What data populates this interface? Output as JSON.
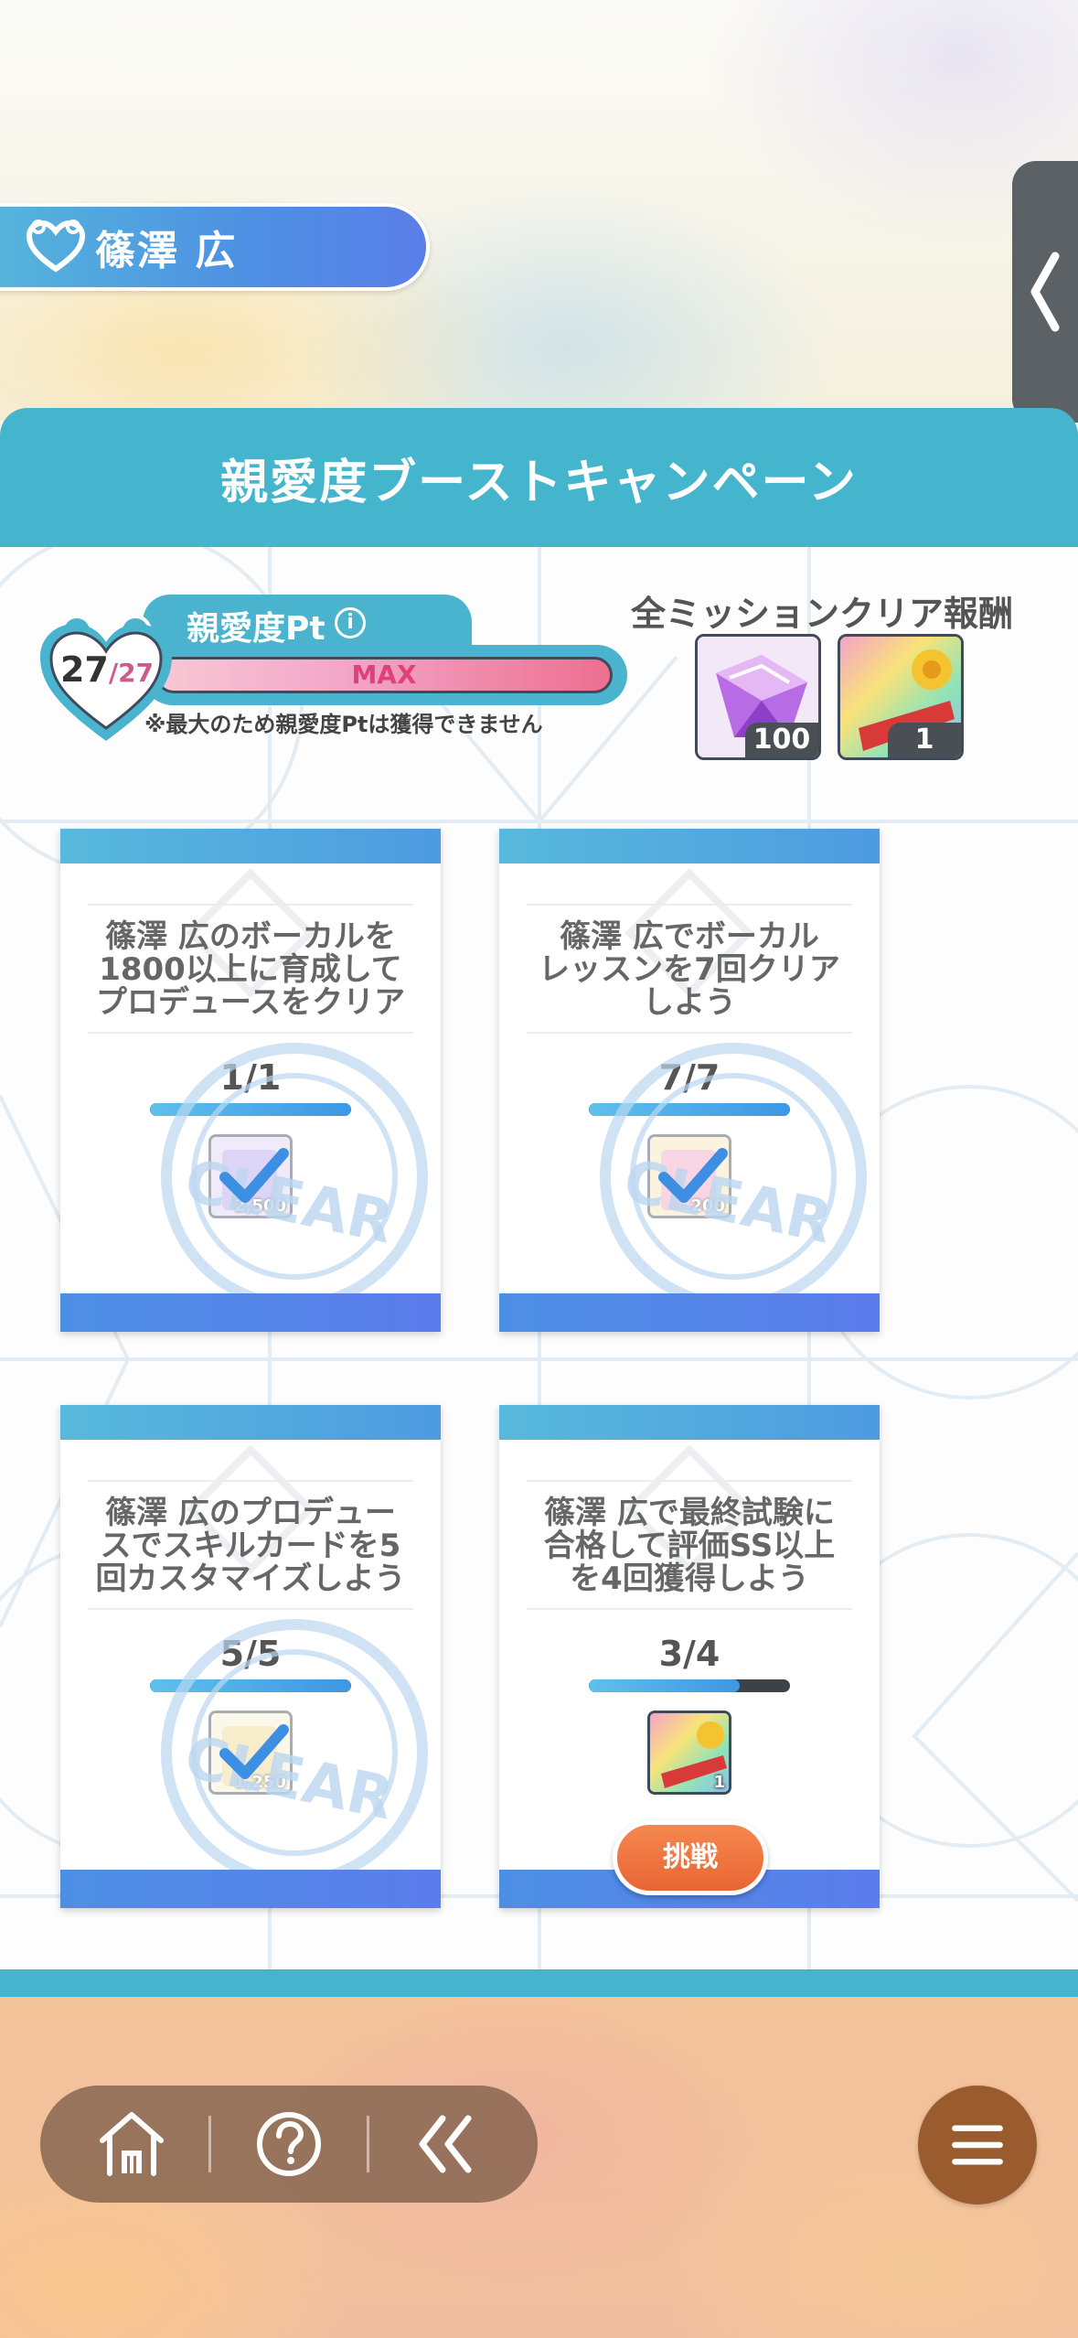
{
  "character": {
    "name": "篠澤 広"
  },
  "campaign": {
    "title": "親愛度ブーストキャンペーン"
  },
  "affection": {
    "label": "親愛度Pt",
    "info_symbol": "i",
    "current": "27",
    "max": "/27",
    "bar_label": "MAX",
    "fill_fraction": 1.0,
    "note": "※最大のため親愛度Ptは獲得できません"
  },
  "all_mission_reward": {
    "title": "全ミッションクリア報酬",
    "items": [
      {
        "icon": "jewel-icon",
        "count": "100"
      },
      {
        "icon": "support-card-book-icon",
        "count": "1"
      }
    ]
  },
  "missions": [
    {
      "text": "篠澤 広のボーカルを\n1800以上に育成して\nプロデュースをクリア",
      "progress": "1/1",
      "fraction": 1.0,
      "reward_count": "2,500",
      "cleared": true,
      "clear_text": "CLEAR"
    },
    {
      "text": "篠澤 広でボーカル\nレッスンを7回クリア\nしよう",
      "progress": "7/7",
      "fraction": 1.0,
      "reward_count": "200",
      "cleared": true,
      "clear_text": "CLEAR"
    },
    {
      "text": "篠澤 広のプロデュー\nスでスキルカードを5\n回カスタマイズしよう",
      "progress": "5/5",
      "fraction": 1.0,
      "reward_count": "1,250",
      "cleared": true,
      "clear_text": "CLEAR"
    },
    {
      "text": "篠澤 広で最終試験に\n合格して評価SS以上\nを4回獲得しよう",
      "progress": "3/4",
      "fraction": 0.75,
      "reward_count": "1",
      "cleared": false
    }
  ],
  "challenge_button": {
    "label": "挑戦"
  },
  "nav": {
    "home_icon": "home-icon",
    "help_icon": "help-icon",
    "back_icon": "back-icon",
    "menu_icon": "menu-icon"
  },
  "colors": {
    "accent": "#44b5cd",
    "card_bar": "#4e8fe3",
    "challenge": "#ea6534"
  }
}
